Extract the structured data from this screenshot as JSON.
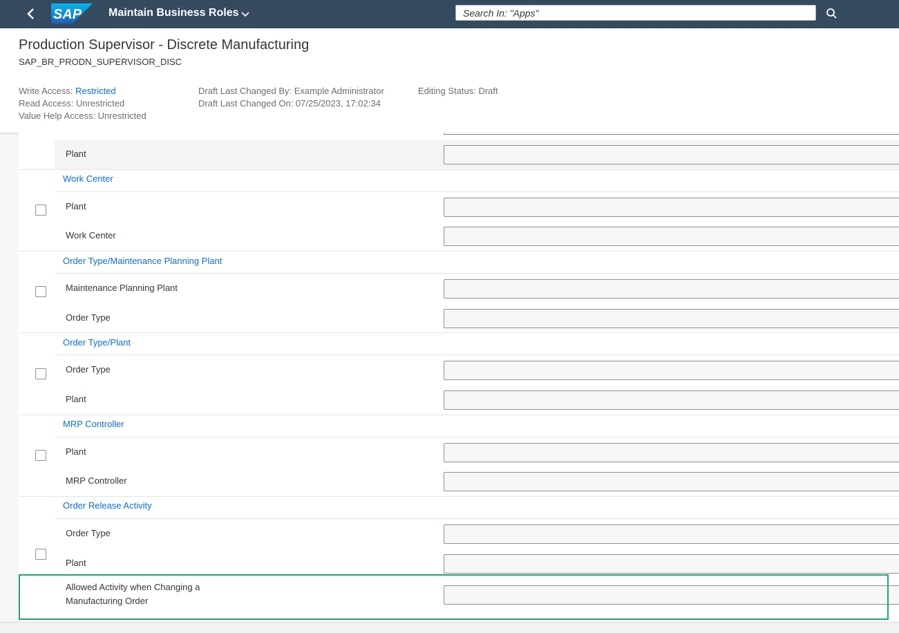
{
  "shell": {
    "app_title": "Maintain Business Roles",
    "search_placeholder": "Search In: \"Apps\"",
    "logo_text": "SAP",
    "colors": {
      "shell_bg": "#354a5f",
      "link": "#0a6ed1",
      "highlight": "#19a979"
    }
  },
  "header": {
    "title": "Production Supervisor - Discrete Manufacturing",
    "subtitle": "SAP_BR_PRODN_SUPERVISOR_DISC",
    "write_access_label": "Write Access:",
    "write_access_value": "Restricted",
    "read_access": "Read Access: Unrestricted",
    "value_help_access": "Value Help Access: Unrestricted",
    "draft_changed_by": "Draft Last Changed By: Example Administrator",
    "draft_changed_on": "Draft Last Changed On: 07/25/2023, 17:02:34",
    "editing_status": "Editing Status: Draft"
  },
  "content": {
    "top_row_label": "Plant",
    "groups": [
      {
        "title": "Work Center",
        "fields": [
          "Plant",
          "Work Center"
        ]
      },
      {
        "title": "Order Type/Maintenance Planning Plant",
        "fields": [
          "Maintenance Planning Plant",
          "Order Type"
        ]
      },
      {
        "title": "Order Type/Plant",
        "fields": [
          "Order Type",
          "Plant"
        ]
      },
      {
        "title": "MRP Controller",
        "fields": [
          "Plant",
          "MRP Controller"
        ]
      },
      {
        "title": "Order Release Activity",
        "fields": [
          "Order Type",
          "Plant"
        ]
      }
    ],
    "last_field_line1": "Allowed Activity when Changing a",
    "last_field_line2": "Manufacturing Order"
  }
}
